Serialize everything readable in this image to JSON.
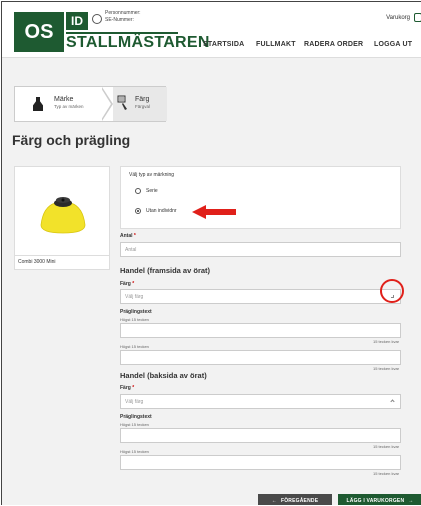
{
  "header": {
    "logo_os": "OS",
    "logo_id": "ID",
    "logo_name": "STALLMÄSTAREN",
    "person_line1": "Personnummer:",
    "person_line2": "SE-Nummer:",
    "cart_label": "Varukorg",
    "nav": [
      "STARTSIDA",
      "FULLMAKT",
      "RADERA ORDER",
      "LOGGA UT"
    ]
  },
  "steps": [
    {
      "title": "Märke",
      "subtitle": "Typ av märken"
    },
    {
      "title": "Färg",
      "subtitle": "Färgval"
    }
  ],
  "page_title": "Färg och prägling",
  "product": {
    "name": "Combi 3000 Mini"
  },
  "form": {
    "type_title": "Välj typ av märkning",
    "type_options": [
      "Serie",
      "Utan individnr"
    ],
    "type_selected": "Utan individnr",
    "antal_label": "Antal",
    "antal_placeholder": "Antal",
    "front_heading": "Handel (framsida av örat)",
    "back_heading": "Handel (baksida av örat)",
    "farg_label": "Färg",
    "farg_placeholder": "Välj färg",
    "praeg_label": "Präglingstext",
    "max_hint": "Högst 15 tecken",
    "counter": "15 tecken kvar"
  },
  "buttons": {
    "prev": "FÖREGÅENDE",
    "next": "LÄGG I VARUKORGEN"
  },
  "colors": {
    "brand_green": "#1e5a31",
    "annotation_red": "#e0201a",
    "tag_yellow": "#f2e22a"
  }
}
